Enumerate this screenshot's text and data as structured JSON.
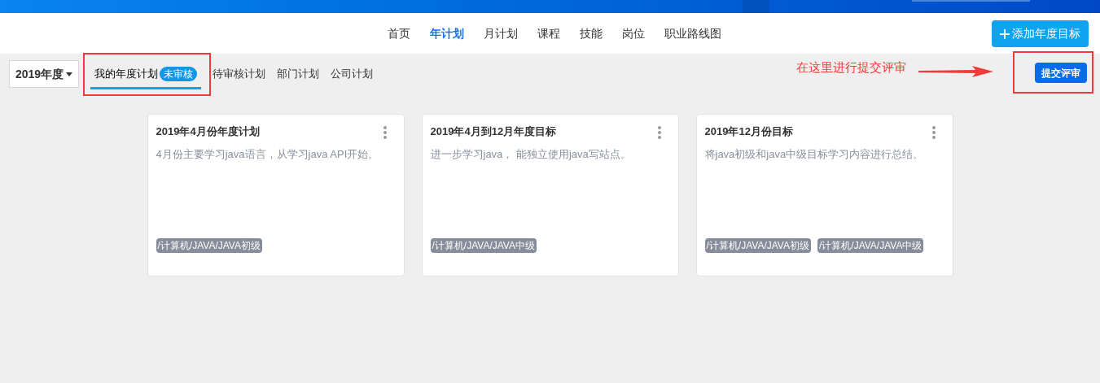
{
  "nav": {
    "items": [
      {
        "label": "首页",
        "selected": false
      },
      {
        "label": "年计划",
        "selected": true
      },
      {
        "label": "月计划",
        "selected": false
      },
      {
        "label": "课程",
        "selected": false
      },
      {
        "label": "技能",
        "selected": false
      },
      {
        "label": "岗位",
        "selected": false
      },
      {
        "label": "职业路线图",
        "selected": false
      }
    ],
    "add_button": "添加年度目标"
  },
  "year_select": "2019年度",
  "tabs": [
    {
      "label": "我的年度计划",
      "badge": "未审核",
      "selected": true
    },
    {
      "label": "待审核计划",
      "selected": false
    },
    {
      "label": "部门计划",
      "selected": false
    },
    {
      "label": "公司计划",
      "selected": false
    }
  ],
  "annotation": "在这里进行提交评审",
  "submit_button": "提交评审",
  "cards": [
    {
      "title": "2019年4月份年度计划",
      "description": "4月份主要学习java语言，从学习java API开始。",
      "tags": [
        "/计算机/JAVA/JAVA初级"
      ]
    },
    {
      "title": "2019年4月到12月年度目标",
      "description": "进一步学习java， 能独立使用java写站点。",
      "tags": [
        "/计算机/JAVA/JAVA中级"
      ]
    },
    {
      "title": "2019年12月份目标",
      "description": "将java初级和java中级目标学习内容进行总结。",
      "tags": [
        "/计算机/JAVA/JAVA初级",
        "/计算机/JAVA/JAVA中级"
      ]
    }
  ]
}
